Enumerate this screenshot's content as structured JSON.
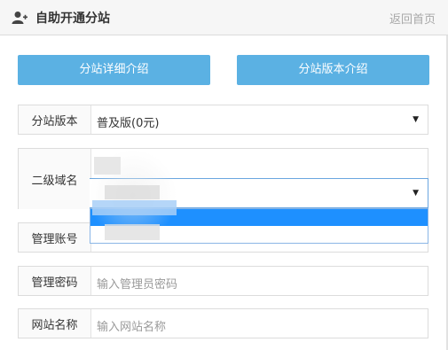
{
  "header": {
    "title": "自助开通分站",
    "back_link": "返回首页"
  },
  "buttons": {
    "detail": "分站详细介绍",
    "version": "分站版本介绍"
  },
  "form": {
    "version": {
      "label": "分站版本",
      "value": "普及版(0元)"
    },
    "domain": {
      "label": "二级域名"
    },
    "account": {
      "label": "管理账号"
    },
    "password": {
      "label": "管理密码",
      "placeholder": "输入管理员密码"
    },
    "site_name": {
      "label": "网站名称",
      "placeholder": "输入网站名称"
    }
  },
  "icons": {
    "header": "user-plus-icon",
    "select": "caret-down-icon"
  },
  "colors": {
    "button_bg": "#5bb1e3",
    "selected_option": "#1e90ff"
  }
}
